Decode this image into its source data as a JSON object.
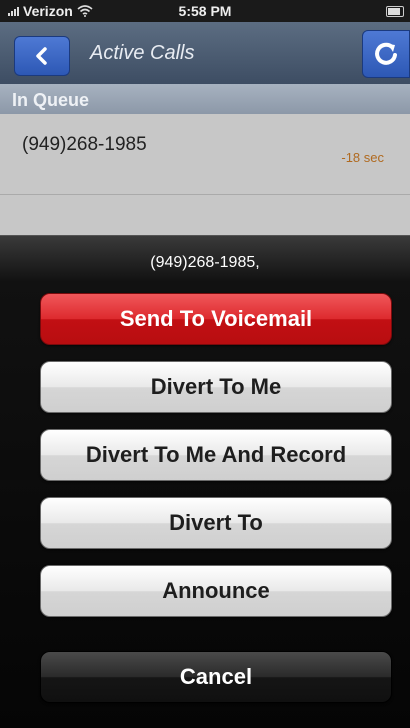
{
  "status_bar": {
    "carrier": "Verizon",
    "time": "5:58 PM"
  },
  "nav": {
    "title": "Active Calls",
    "back_icon": "chevron-left-icon",
    "refresh_icon": "refresh-icon"
  },
  "section": {
    "label": "In Queue"
  },
  "calls": [
    {
      "number": "(949)268-1985",
      "wait": "-18 sec"
    }
  ],
  "sheet": {
    "title": "(949)268-1985,",
    "buttons": [
      {
        "label": "Send To Voicemail",
        "style": "red"
      },
      {
        "label": "Divert To Me",
        "style": "light"
      },
      {
        "label": "Divert To Me And Record",
        "style": "light"
      },
      {
        "label": "Divert To",
        "style": "light"
      },
      {
        "label": "Announce",
        "style": "light"
      },
      {
        "label": "Cancel",
        "style": "dark"
      }
    ]
  },
  "colors": {
    "nav_button": "#3a66c4",
    "destructive": "#d2191d",
    "wait_time": "#b06a20"
  }
}
